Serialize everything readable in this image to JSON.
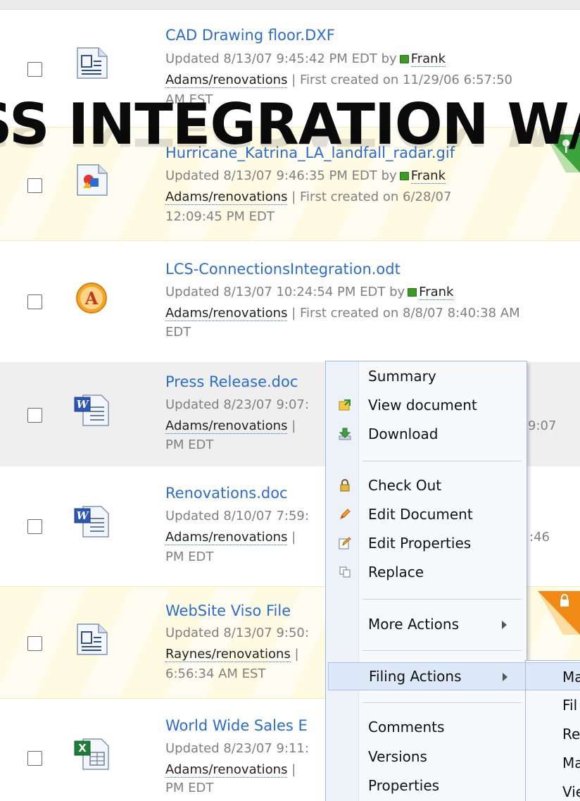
{
  "documents": [
    {
      "title": "CAD Drawing floor.DXF",
      "updated": "Updated 8/13/07 9:45:42 PM EDT by",
      "user_first": "Frank",
      "user_second": "Adams/renovations",
      "created_a": " | First created on 11/29/06 6:57:50",
      "created_b": "AM EST",
      "icon": "generic-document-icon",
      "style": "plain"
    },
    {
      "title": "Hurricane_Katrina_LA_landfall_radar.gif",
      "updated": "Updated 8/13/07 9:46:35 PM EDT by",
      "user_first": "Frank",
      "user_second": "Adams/renovations",
      "created_a": " | First created on 6/28/07",
      "created_b": "12:09:45 PM EDT",
      "icon": "image-file-icon",
      "style": "yellow"
    },
    {
      "title": "LCS-ConnectionsIntegration.odt",
      "updated": "Updated 8/13/07 10:24:54 PM EDT by",
      "user_first": "Frank",
      "user_second": "Adams/renovations",
      "created_a": " | First created on 8/8/07 8:40:38 AM",
      "created_b": "EDT",
      "icon": "odt-document-icon",
      "style": "plain"
    },
    {
      "title": "Press Release.doc",
      "updated": "Updated 8/23/07 9:07:",
      "user_second": "Adams/renovations",
      "created_a": " |",
      "created_tail": "9:07",
      "created_b": "PM EDT",
      "icon": "word-document-icon",
      "style": "grey"
    },
    {
      "title": "Renovations.doc",
      "updated": "Updated 8/10/07 7:59:",
      "user_second": "Adams/renovations",
      "created_a": " |",
      "created_tail": ":46",
      "created_b": "PM EDT",
      "icon": "word-document-icon",
      "style": "plain"
    },
    {
      "title": "WebSite Viso File",
      "updated": "Updated 8/13/07 9:50:",
      "user_second": "Raynes/renovations",
      "created_a": " |",
      "created_b": "6:56:34 AM EST",
      "icon": "generic-document-icon",
      "style": "yellow"
    },
    {
      "title": "World Wide Sales E",
      "updated": "Updated 8/23/07 9:11:",
      "user_second": "Adams/renovations",
      "created_a": " |",
      "created_b": "PM EDT",
      "icon": "excel-document-icon",
      "style": "plain"
    }
  ],
  "overlay_text": "SS INTEGRATION W/",
  "context_menu": {
    "items": [
      {
        "label": "Summary",
        "icon": ""
      },
      {
        "label": "View document",
        "icon": "view-document-icon"
      },
      {
        "label": "Download",
        "icon": "download-icon"
      },
      {
        "label": "Check Out",
        "icon": "lock-icon"
      },
      {
        "label": "Edit Document",
        "icon": "pencil-icon"
      },
      {
        "label": "Edit Properties",
        "icon": "edit-properties-icon"
      },
      {
        "label": "Replace",
        "icon": "replace-icon"
      },
      {
        "label": "More Actions",
        "icon": ""
      },
      {
        "label": "Filing Actions",
        "icon": ""
      },
      {
        "label": "Comments",
        "icon": ""
      },
      {
        "label": "Versions",
        "icon": ""
      },
      {
        "label": "Properties",
        "icon": ""
      }
    ]
  },
  "submenu": {
    "items": [
      "Ma",
      "Fil",
      "Re",
      "Ma",
      "Vie"
    ]
  },
  "colors": {
    "link": "#2a6ccf",
    "highlight_row": "#fffbe3",
    "selected_row": "#efefef",
    "menu_highlight": "#dde8f8"
  }
}
